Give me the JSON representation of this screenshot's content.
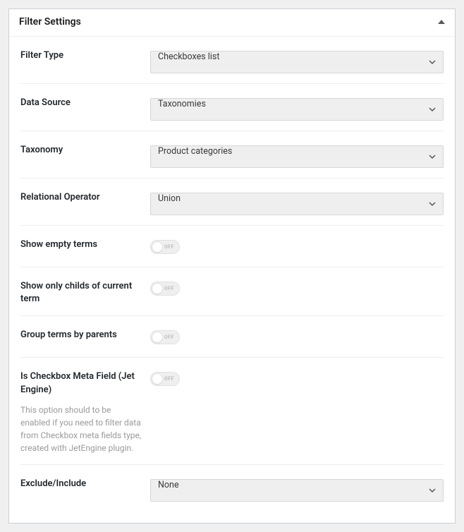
{
  "panel": {
    "title": "Filter Settings"
  },
  "fields": {
    "filter_type": {
      "label": "Filter Type",
      "value": "Checkboxes list"
    },
    "data_source": {
      "label": "Data Source",
      "value": "Taxonomies"
    },
    "taxonomy": {
      "label": "Taxonomy",
      "value": "Product categories"
    },
    "relational_operator": {
      "label": "Relational Operator",
      "value": "Union"
    },
    "show_empty_terms": {
      "label": "Show empty terms",
      "state": "OFF"
    },
    "show_only_childs": {
      "label": "Show only childs of current term",
      "state": "OFF"
    },
    "group_by_parents": {
      "label": "Group terms by parents",
      "state": "OFF"
    },
    "is_checkbox_meta": {
      "label": "Is Checkbox Meta Field (Jet Engine)",
      "state": "OFF",
      "description": "This option should to be enabled if you need to filter data from Checkbox meta fields type, created with JetEngine plugin."
    },
    "exclude_include": {
      "label": "Exclude/Include",
      "value": "None"
    }
  }
}
